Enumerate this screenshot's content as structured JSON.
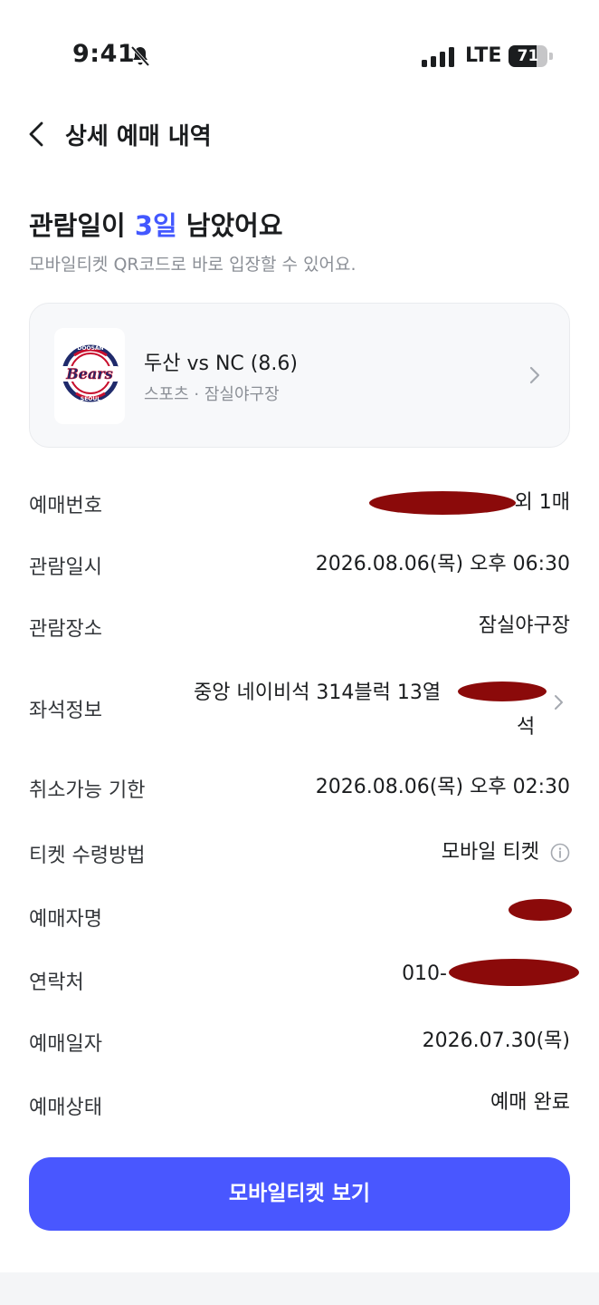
{
  "status_bar": {
    "time": "9:41",
    "network": "LTE",
    "battery": "71",
    "battery_level": 0.71
  },
  "header": {
    "title": "상세 예매 내역"
  },
  "summary": {
    "headline_prefix": "관람일이 ",
    "headline_highlight": "3일",
    "headline_suffix": " 남았어요",
    "subtext": "모바일티켓 QR코드로 바로 입장할 수 있어요."
  },
  "event": {
    "title": "두산 vs NC (8.6)",
    "subtitle": "스포츠 · 잠실야구장",
    "logo_text": "Bears",
    "logo_top_text": "DOOSAN",
    "logo_bottom_text": "SEOUL"
  },
  "details": {
    "booking_number": {
      "label": "예매번호",
      "value_visible": "외 1매"
    },
    "viewing_datetime": {
      "label": "관람일시",
      "value": "2026.08.06(목) 오후 06:30"
    },
    "venue": {
      "label": "관람장소",
      "value": "잠실야구장"
    },
    "seat": {
      "label": "좌석정보",
      "value_line1": "중앙 네이비석 314블럭 13열",
      "value_line2": "석"
    },
    "cancel_deadline": {
      "label": "취소가능 기한",
      "value": "2026.08.06(목) 오후 02:30"
    },
    "ticket_method": {
      "label": "티켓 수령방법",
      "value": "모바일 티켓"
    },
    "booker_name": {
      "label": "예매자명"
    },
    "contact": {
      "label": "연락처",
      "value_visible": "010-"
    },
    "booking_date": {
      "label": "예매일자",
      "value": "2026.07.30(목)"
    },
    "booking_status": {
      "label": "예매상태",
      "value": "예매 완료"
    }
  },
  "actions": {
    "mobile_ticket_button": "모바일티켓 보기"
  },
  "colors": {
    "accent": "#4358ff",
    "button": "#4957ff",
    "redaction": "#8b0a0a",
    "logo_navy": "#1f2a6b",
    "logo_red": "#c8102e"
  }
}
